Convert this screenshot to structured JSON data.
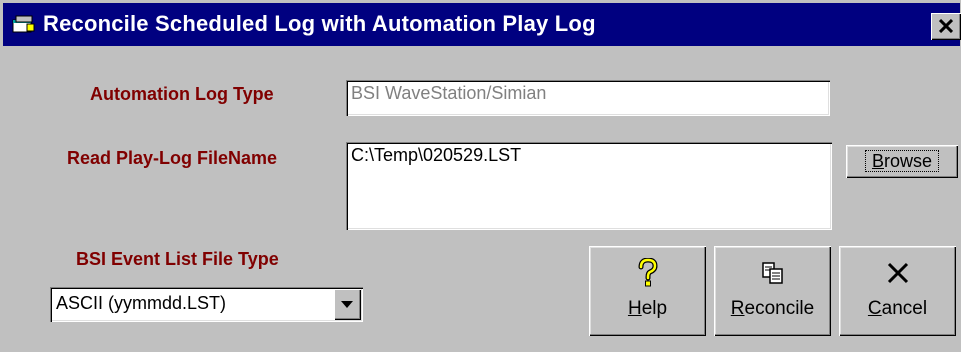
{
  "window": {
    "title": "Reconcile Scheduled Log with Automation Play Log",
    "close_label": "x"
  },
  "form": {
    "automation_log_type_label": "Automation Log Type",
    "automation_log_type_value": "BSI WaveStation/Simian",
    "play_log_filename_label": "Read Play-Log FileName",
    "play_log_filename_value": "C:\\Temp\\020529.LST",
    "event_list_type_label": "BSI Event List File Type",
    "event_list_type_value": "ASCII (yymmdd.LST)"
  },
  "buttons": {
    "browse": {
      "mnemonic": "B",
      "rest": "rowse"
    },
    "help": {
      "mnemonic": "H",
      "rest": "elp",
      "icon": "question-icon"
    },
    "reconcile": {
      "mnemonic": "R",
      "rest": "econcile",
      "icon": "copy-icon"
    },
    "cancel": {
      "mnemonic": "C",
      "rest": "ancel",
      "icon": "x-icon"
    }
  },
  "colors": {
    "title_bar": "#000080",
    "label_text": "#800000",
    "face": "#c0c0c0"
  }
}
